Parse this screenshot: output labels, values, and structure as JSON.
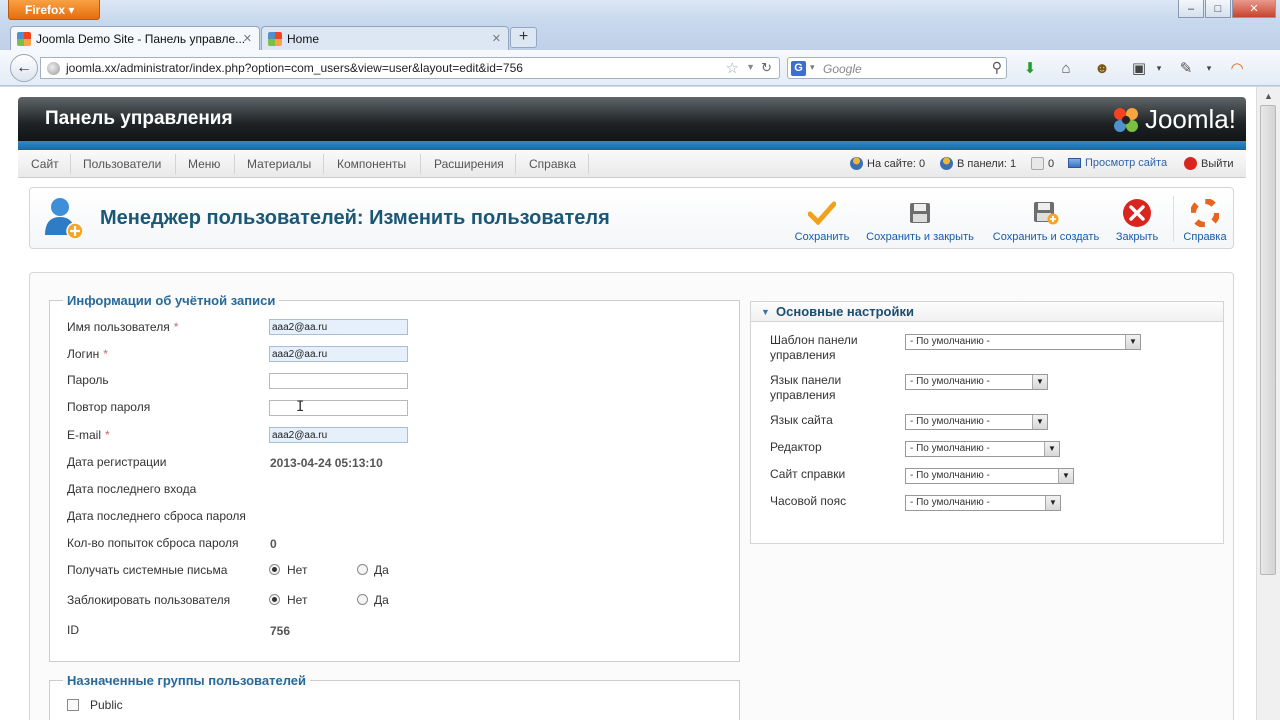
{
  "browser": {
    "app_button": "Firefox",
    "tabs": [
      {
        "title": "Joomla Demo Site - Панель управле..."
      },
      {
        "title": "Home"
      }
    ],
    "new_tab": "+",
    "url": "joomla.xx/administrator/index.php?option=com_users&view=user&layout=edit&id=756",
    "search_engine": "G",
    "search_placeholder": "Google"
  },
  "header": {
    "title": "Панель управления",
    "logo_text": "Joomla!"
  },
  "menu": {
    "items": [
      "Сайт",
      "Пользователи",
      "Меню",
      "Материалы",
      "Компоненты",
      "Расширения",
      "Справка"
    ],
    "status": {
      "on_site": "На сайте: 0",
      "in_panel": "В панели: 1",
      "messages": "0",
      "view_site": "Просмотр сайта",
      "logout": "Выйти"
    }
  },
  "toolbar": {
    "title": "Менеджер пользователей: Изменить пользователя",
    "buttons": {
      "save": "Сохранить",
      "save_close": "Сохранить и закрыть",
      "save_new": "Сохранить и создать",
      "close": "Закрыть",
      "help": "Справка"
    }
  },
  "account": {
    "legend": "Информации об учётной записи",
    "fields": {
      "username_label": "Имя пользователя",
      "username_value": "aaa2@aa.ru",
      "login_label": "Логин",
      "login_value": "aaa2@aa.ru",
      "password_label": "Пароль",
      "password_value": "",
      "password2_label": "Повтор пароля",
      "password2_value": "",
      "email_label": "E-mail",
      "email_value": "aaa2@aa.ru",
      "register_date_label": "Дата регистрации",
      "register_date_value": "2013-04-24 05:13:10",
      "last_visit_label": "Дата последнего входа",
      "last_reset_label": "Дата последнего сброса пароля",
      "reset_count_label": "Кол-во попыток сброса пароля",
      "reset_count_value": "0",
      "send_email_label": "Получать системные письма",
      "block_label": "Заблокировать пользователя",
      "id_label": "ID",
      "id_value": "756"
    },
    "radio_no": "Нет",
    "radio_yes": "Да",
    "required_mark": "*"
  },
  "groups": {
    "legend": "Назначенные группы пользователей",
    "items": [
      "Public"
    ]
  },
  "basic_settings": {
    "title": "Основные настройки",
    "rows": [
      {
        "label": "Шаблон панели управления",
        "value": "- По умолчанию -"
      },
      {
        "label": "Язык панели управления",
        "value": "- По умолчанию -"
      },
      {
        "label": "Язык сайта",
        "value": "- По умолчанию -"
      },
      {
        "label": "Редактор",
        "value": "- По умолчанию -"
      },
      {
        "label": "Сайт справки",
        "value": "- По умолчанию -"
      },
      {
        "label": "Часовой пояс",
        "value": "- По умолчанию -"
      }
    ],
    "label_line1": [
      "Шаблон панели",
      "Язык панели"
    ],
    "label_line2": [
      "управления",
      "управления"
    ]
  },
  "colors": {
    "accent_blue": "#1b5777",
    "legend_blue": "#266a9b",
    "link_blue": "#135cae",
    "strip_blue": "#2a8bd0",
    "save_orange": "#f0a21b",
    "close_red": "#d8251d"
  }
}
